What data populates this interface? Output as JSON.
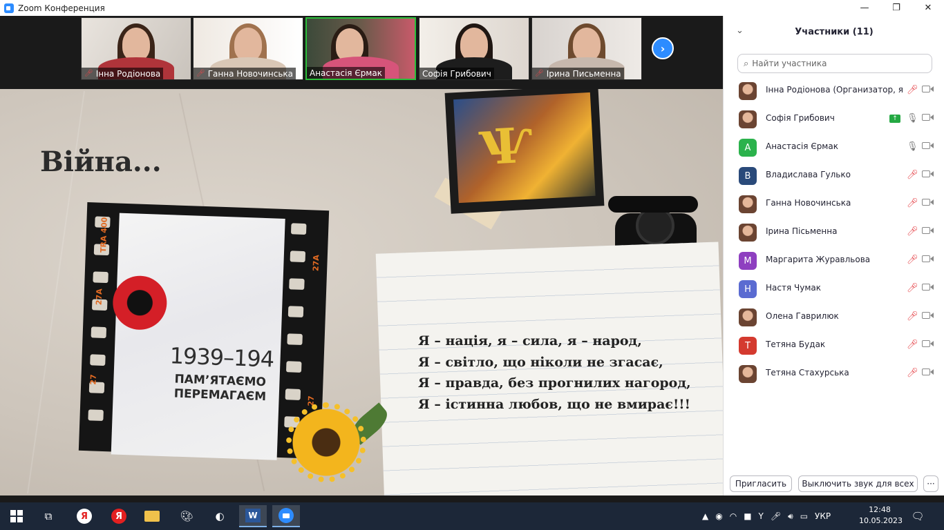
{
  "window": {
    "title": "Zoom Конференция",
    "minimize": "—",
    "maximize": "❐",
    "close": "✕"
  },
  "thumbnails": [
    {
      "name": "Інна Родіонова",
      "muted": true
    },
    {
      "name": "Ганна Новочинська",
      "muted": true
    },
    {
      "name": "Анастасія Єрмак",
      "muted": false,
      "active": true
    },
    {
      "name": "Софія Грибович",
      "muted": false
    },
    {
      "name": "Ірина Письменна",
      "muted": true
    }
  ],
  "thumbnail_next": "›",
  "slide": {
    "heading": "Війна...",
    "years": "1939–194",
    "remember": [
      "ПАМ’ЯТАЄМО",
      "ПЕРЕМАГАЄМ"
    ],
    "film_labels": [
      "TRA 400",
      "27A",
      "27",
      "27A",
      "27"
    ],
    "poem": [
      "Я – нація, я – сила, я – народ,",
      "Я – світло, що ніколи не згасає,",
      "Я – правда, без прогнилих нагород,",
      "Я – істинна любов, що не вмирає!!!"
    ],
    "trident": "Ѱ"
  },
  "participants_panel": {
    "collapse_icon": "⌄",
    "title": "Участники (11)",
    "search_placeholder": "Найти участника",
    "participants": [
      {
        "name": "Інна Родіонова (Организатор, я)",
        "avatar": "",
        "color": "",
        "mic": "off"
      },
      {
        "name": "Софія Грибович",
        "avatar": "",
        "color": "",
        "mic": "on",
        "sharing": true
      },
      {
        "name": "Анастасія Єрмак",
        "avatar": "А",
        "color": "#2bb24c",
        "mic": "on"
      },
      {
        "name": "Владислава Гулько",
        "avatar": "В",
        "color": "#2a4a7a",
        "mic": "off"
      },
      {
        "name": "Ганна Новочинська",
        "avatar": "",
        "color": "",
        "mic": "off"
      },
      {
        "name": "Ірина Пісьменна",
        "avatar": "",
        "color": "",
        "mic": "off"
      },
      {
        "name": "Маргарита Журавльова",
        "avatar": "М",
        "color": "#8e3fc0",
        "mic": "off"
      },
      {
        "name": "Настя Чумак",
        "avatar": "Н",
        "color": "#5a6bd1",
        "mic": "off"
      },
      {
        "name": "Олена Гаврилюк",
        "avatar": "",
        "color": "",
        "mic": "off"
      },
      {
        "name": "Тетяна Будак",
        "avatar": "Т",
        "color": "#d43a2f",
        "mic": "off"
      },
      {
        "name": "Тетяна Стахурська",
        "avatar": "",
        "color": "",
        "mic": "off"
      }
    ],
    "invite_label": "Пригласить",
    "mute_all_label": "Выключить звук для всех",
    "more_label": "···"
  },
  "taskbar": {
    "yandex_letter": "Я",
    "word_letter": "W",
    "language": "УКР",
    "time": "12:48",
    "date": "10.05.2023"
  }
}
